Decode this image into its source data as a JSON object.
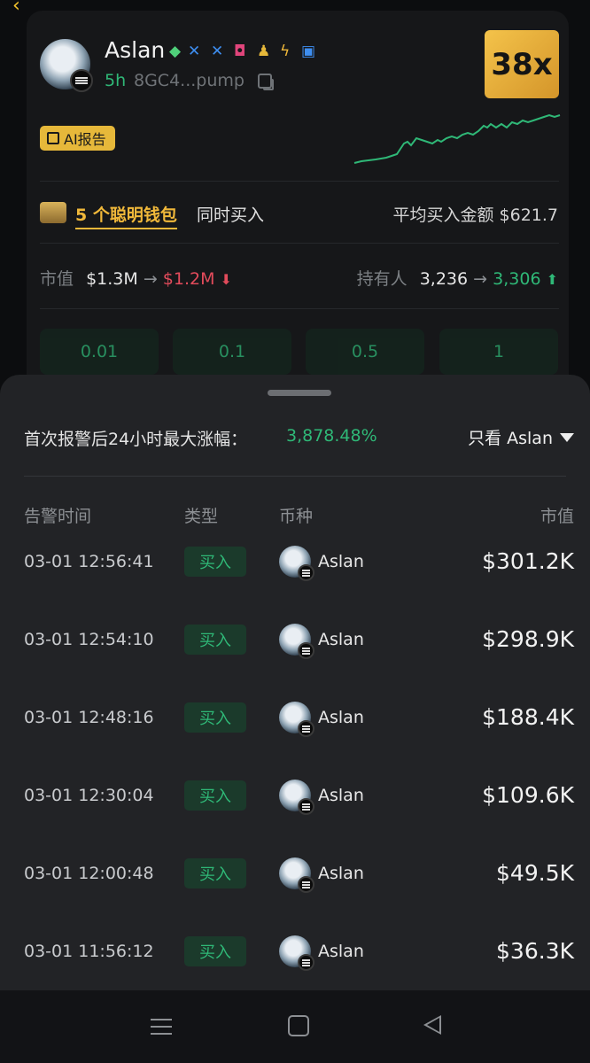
{
  "token": {
    "name": "Aslan",
    "age": "5h",
    "address": "8GC4...pump",
    "multiplier": "38x",
    "ai_report_label": "AI报告",
    "social_icons": [
      "pill-icon",
      "x-icon",
      "x-icon",
      "instagram-icon",
      "community-icon",
      "bolt-icon",
      "chat-icon"
    ],
    "colors": {
      "accent_green": "#2fb877",
      "accent_gold": "#f0b83a",
      "down_red": "#e24b5b"
    }
  },
  "smart_money": {
    "count_label": "5 个聪明钱包",
    "suffix": "同时买入",
    "avg_label": "平均买入金额",
    "avg_value": "$621.7"
  },
  "stats": {
    "mcap_label": "市值",
    "mcap_from": "$1.3M",
    "mcap_to": "$1.2M",
    "holders_label": "持有人",
    "holders_from": "3,236",
    "holders_to": "3,306"
  },
  "amount_buttons": [
    "0.01",
    "0.1",
    "0.5",
    "1"
  ],
  "sheet": {
    "gain_label": "首次报警后24小时最大涨幅：",
    "gain_value": "3,878.48%",
    "filter_label": "只看 Aslan",
    "headers": {
      "time": "告警时间",
      "type": "类型",
      "coin": "币种",
      "mcap": "市值"
    },
    "rows": [
      {
        "time": "03-01 12:56:41",
        "type": "买入",
        "coin": "Aslan",
        "mcap": "$301.2K"
      },
      {
        "time": "03-01 12:54:10",
        "type": "买入",
        "coin": "Aslan",
        "mcap": "$298.9K"
      },
      {
        "time": "03-01 12:48:16",
        "type": "买入",
        "coin": "Aslan",
        "mcap": "$188.4K"
      },
      {
        "time": "03-01 12:30:04",
        "type": "买入",
        "coin": "Aslan",
        "mcap": "$109.6K"
      },
      {
        "time": "03-01 12:00:48",
        "type": "买入",
        "coin": "Aslan",
        "mcap": "$49.5K"
      },
      {
        "time": "03-01 11:56:12",
        "type": "买入",
        "coin": "Aslan",
        "mcap": "$36.3K"
      }
    ]
  },
  "navbar": {
    "icons": [
      "menu-icon",
      "home-icon",
      "back-icon"
    ]
  }
}
